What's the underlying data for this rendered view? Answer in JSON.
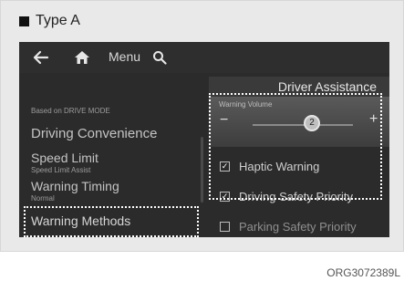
{
  "header": {
    "type_label": "Type A"
  },
  "topbar": {
    "back_icon": "back-arrow-icon",
    "home_icon": "home-icon",
    "menu_label": "Menu",
    "search_icon": "search-icon"
  },
  "left_menu": {
    "section_label": "Based on DRIVE MODE",
    "items": [
      {
        "label": "Driving Convenience",
        "sub": ""
      },
      {
        "label": "Speed Limit",
        "sub": "Speed Limit Assist"
      },
      {
        "label": "Warning Timing",
        "sub": "Normal"
      },
      {
        "label": "Warning Methods",
        "sub": ""
      }
    ]
  },
  "right_panel": {
    "title": "Driver Assistance",
    "volume": {
      "title": "Warning Volume",
      "minus": "−",
      "plus": "+",
      "value": "2"
    },
    "options": [
      {
        "label": "Haptic Warning",
        "checked": true
      },
      {
        "label": "Driving Safety Priority",
        "checked": true
      },
      {
        "label": "Parking Safety Priority",
        "checked": false
      }
    ]
  },
  "footer": {
    "code": "ORG3072389L"
  }
}
